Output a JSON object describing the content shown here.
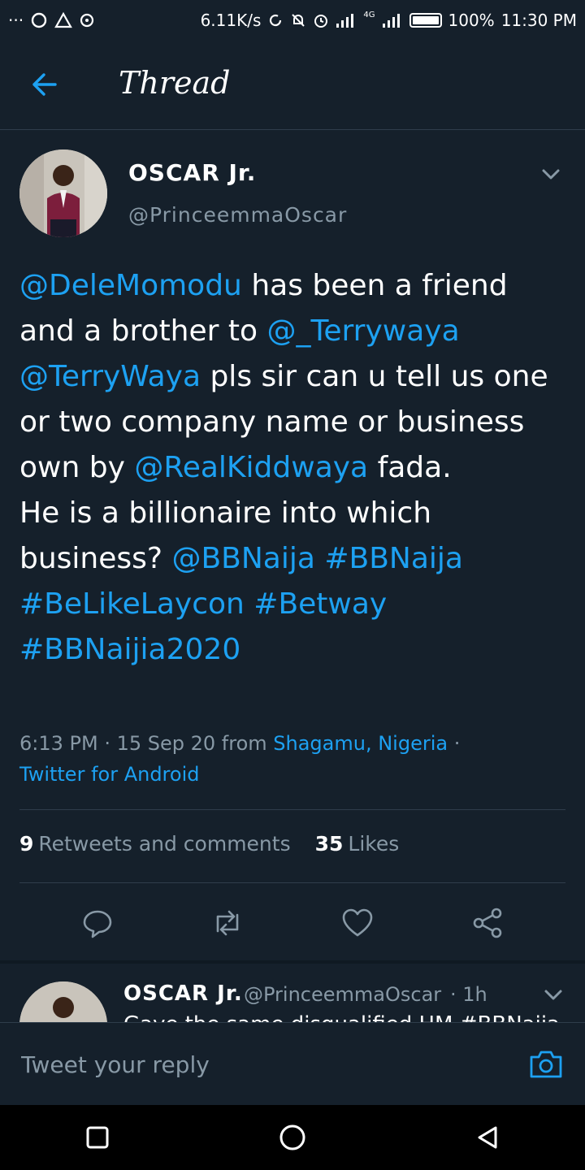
{
  "status_bar": {
    "left_glyph": "···",
    "speed": "6.11K/s",
    "network": "4G",
    "battery": "100%",
    "time": "11:30 PM"
  },
  "header": {
    "title": "Thread"
  },
  "tweet": {
    "author_name": "OSCAR Jr.",
    "author_handle": "@PrinceemmaOscar",
    "segments": [
      {
        "text": "@DeleMomodu",
        "link": true
      },
      {
        "text": " has been a friend and a brother to ",
        "link": false
      },
      {
        "text": "@_Terrywaya",
        "link": true
      },
      {
        "text": " ",
        "link": false
      },
      {
        "text": "@TerryWaya",
        "link": true
      },
      {
        "text": " pls sir can u tell us one or two company name or business own by ",
        "link": false
      },
      {
        "text": "@RealKiddwaya",
        "link": true
      },
      {
        "text": " fada.",
        "link": false
      },
      {
        "text": "\n",
        "link": false
      },
      {
        "text": "He is a billionaire into which business? ",
        "link": false
      },
      {
        "text": "@BBNaija",
        "link": true
      },
      {
        "text": " ",
        "link": false
      },
      {
        "text": "#BBNaija",
        "link": true
      },
      {
        "text": " ",
        "link": false
      },
      {
        "text": "#BeLikeLaycon",
        "link": true
      },
      {
        "text": " ",
        "link": false
      },
      {
        "text": "#Betway",
        "link": true
      },
      {
        "text": " ",
        "link": false
      },
      {
        "text": "#BBNaijia2020",
        "link": true
      }
    ],
    "timestamp": "6:13 PM · 15 Sep 20 from ",
    "location": "Shagamu, Nigeria",
    "separator": " · ",
    "client": "Twitter for Android",
    "retweets_count": "9",
    "retweets_label": "Retweets and comments",
    "likes_count": "35",
    "likes_label": "Likes"
  },
  "reply_preview": {
    "author_name": "OSCAR Jr.",
    "author_handle": "@PrinceemmaOscar",
    "time": "· 1h",
    "text_partial": "Gave the same disqualified HM #BBNaija"
  },
  "composer": {
    "placeholder": "Tweet your reply"
  },
  "colors": {
    "background": "#15202b",
    "accent": "#1da1f2",
    "muted": "#8899a6",
    "divider": "#2f3d4b"
  },
  "icons": [
    "back-arrow-icon",
    "chevron-down-icon",
    "reply-icon",
    "retweet-icon",
    "like-icon",
    "share-icon",
    "camera-icon",
    "nav-square-icon",
    "nav-circle-icon",
    "nav-back-icon"
  ]
}
